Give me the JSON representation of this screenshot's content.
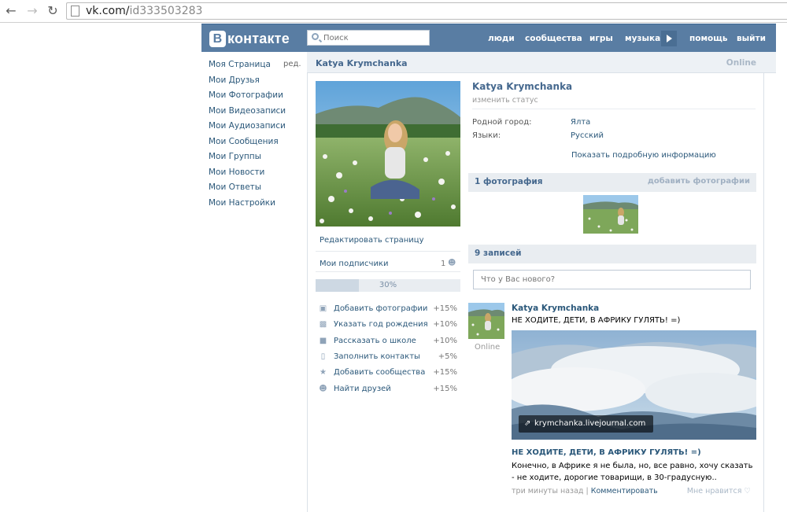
{
  "browser": {
    "url_domain": "vk.com/",
    "url_path": "id333503283"
  },
  "header": {
    "logo_text": "контакте",
    "logo_letter": "В",
    "search_placeholder": "Поиск",
    "nav": [
      "люди",
      "сообщества",
      "игры",
      "музыка",
      "помощь",
      "выйти"
    ]
  },
  "sidebar": {
    "items": [
      "Моя Страница",
      "Мои Друзья",
      "Мои Фотографии",
      "Мои Видеозаписи",
      "Мои Аудиозаписи",
      "Мои Сообщения",
      "Мои Группы",
      "Мои Новости",
      "Мои Ответы",
      "Мои Настройки"
    ],
    "edit_label": "ред."
  },
  "profile": {
    "name": "Katya Krymchanka",
    "online": "Online",
    "status_link": "изменить статус",
    "hometown_label": "Родной город:",
    "hometown_value": "Ялта",
    "languages_label": "Языки:",
    "languages_value": "Русский",
    "details_link": "Показать подробную информацию",
    "edit_page": "Редактировать страницу",
    "subscribers_label": "Мои подписчики",
    "subscribers_count": "1",
    "progress_text": "30%",
    "progress_value": 0.3,
    "tips": [
      {
        "icon": "camera-icon",
        "label": "Добавить фотографии",
        "value": "+15%"
      },
      {
        "icon": "gift-icon",
        "label": "Указать год рождения",
        "value": "+10%"
      },
      {
        "icon": "school-icon",
        "label": "Рассказать о школе",
        "value": "+10%"
      },
      {
        "icon": "phone-icon",
        "label": "Заполнить контакты",
        "value": "+5%"
      },
      {
        "icon": "star-icon",
        "label": "Добавить сообщества",
        "value": "+15%"
      },
      {
        "icon": "people-icon",
        "label": "Найти друзей",
        "value": "+15%"
      }
    ]
  },
  "photos": {
    "title": "1 фотография",
    "add_link": "добавить фотографии"
  },
  "wall": {
    "title": "9 записей",
    "placeholder": "Что у Вас нового?",
    "post": {
      "author": "Katya Krymchanka",
      "author_status": "Online",
      "text": "НЕ ХОДИТЕ, ДЕТИ, В АФРИКУ ГУЛЯТЬ! =)",
      "link_caption": "krymchanka.livejournal.com",
      "link_title": "НЕ ХОДИТЕ, ДЕТИ, В АФРИКУ ГУЛЯТЬ! =)",
      "link_desc": "Конечно, в Африке я не была, но, все равно, хочу сказать - не ходите, дорогие товарищи, в 30-градусную..",
      "time": "три минуты назад",
      "separator": "|",
      "comment": "Комментировать",
      "like": "Мне нравится"
    }
  }
}
